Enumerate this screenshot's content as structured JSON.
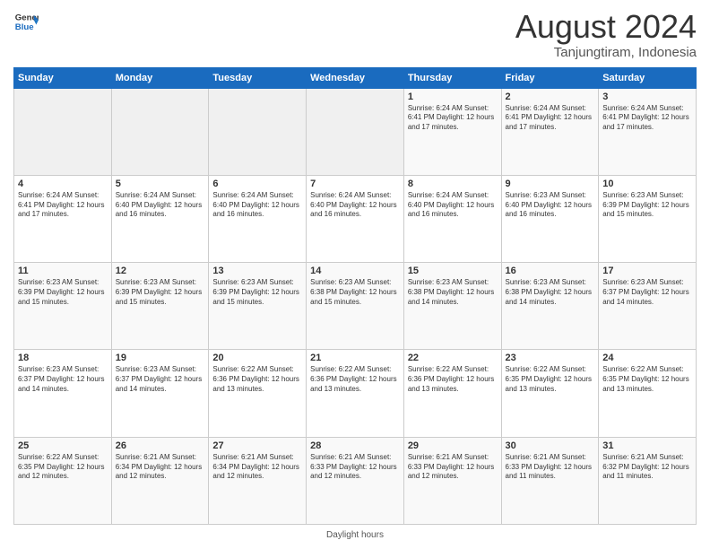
{
  "header": {
    "logo_line1": "General",
    "logo_line2": "Blue",
    "main_title": "August 2024",
    "subtitle": "Tanjungtiram, Indonesia"
  },
  "days_of_week": [
    "Sunday",
    "Monday",
    "Tuesday",
    "Wednesday",
    "Thursday",
    "Friday",
    "Saturday"
  ],
  "weeks": [
    [
      {
        "day": "",
        "info": ""
      },
      {
        "day": "",
        "info": ""
      },
      {
        "day": "",
        "info": ""
      },
      {
        "day": "",
        "info": ""
      },
      {
        "day": "1",
        "info": "Sunrise: 6:24 AM\nSunset: 6:41 PM\nDaylight: 12 hours and 17 minutes."
      },
      {
        "day": "2",
        "info": "Sunrise: 6:24 AM\nSunset: 6:41 PM\nDaylight: 12 hours and 17 minutes."
      },
      {
        "day": "3",
        "info": "Sunrise: 6:24 AM\nSunset: 6:41 PM\nDaylight: 12 hours and 17 minutes."
      }
    ],
    [
      {
        "day": "4",
        "info": "Sunrise: 6:24 AM\nSunset: 6:41 PM\nDaylight: 12 hours and 17 minutes."
      },
      {
        "day": "5",
        "info": "Sunrise: 6:24 AM\nSunset: 6:40 PM\nDaylight: 12 hours and 16 minutes."
      },
      {
        "day": "6",
        "info": "Sunrise: 6:24 AM\nSunset: 6:40 PM\nDaylight: 12 hours and 16 minutes."
      },
      {
        "day": "7",
        "info": "Sunrise: 6:24 AM\nSunset: 6:40 PM\nDaylight: 12 hours and 16 minutes."
      },
      {
        "day": "8",
        "info": "Sunrise: 6:24 AM\nSunset: 6:40 PM\nDaylight: 12 hours and 16 minutes."
      },
      {
        "day": "9",
        "info": "Sunrise: 6:23 AM\nSunset: 6:40 PM\nDaylight: 12 hours and 16 minutes."
      },
      {
        "day": "10",
        "info": "Sunrise: 6:23 AM\nSunset: 6:39 PM\nDaylight: 12 hours and 15 minutes."
      }
    ],
    [
      {
        "day": "11",
        "info": "Sunrise: 6:23 AM\nSunset: 6:39 PM\nDaylight: 12 hours and 15 minutes."
      },
      {
        "day": "12",
        "info": "Sunrise: 6:23 AM\nSunset: 6:39 PM\nDaylight: 12 hours and 15 minutes."
      },
      {
        "day": "13",
        "info": "Sunrise: 6:23 AM\nSunset: 6:39 PM\nDaylight: 12 hours and 15 minutes."
      },
      {
        "day": "14",
        "info": "Sunrise: 6:23 AM\nSunset: 6:38 PM\nDaylight: 12 hours and 15 minutes."
      },
      {
        "day": "15",
        "info": "Sunrise: 6:23 AM\nSunset: 6:38 PM\nDaylight: 12 hours and 14 minutes."
      },
      {
        "day": "16",
        "info": "Sunrise: 6:23 AM\nSunset: 6:38 PM\nDaylight: 12 hours and 14 minutes."
      },
      {
        "day": "17",
        "info": "Sunrise: 6:23 AM\nSunset: 6:37 PM\nDaylight: 12 hours and 14 minutes."
      }
    ],
    [
      {
        "day": "18",
        "info": "Sunrise: 6:23 AM\nSunset: 6:37 PM\nDaylight: 12 hours and 14 minutes."
      },
      {
        "day": "19",
        "info": "Sunrise: 6:23 AM\nSunset: 6:37 PM\nDaylight: 12 hours and 14 minutes."
      },
      {
        "day": "20",
        "info": "Sunrise: 6:22 AM\nSunset: 6:36 PM\nDaylight: 12 hours and 13 minutes."
      },
      {
        "day": "21",
        "info": "Sunrise: 6:22 AM\nSunset: 6:36 PM\nDaylight: 12 hours and 13 minutes."
      },
      {
        "day": "22",
        "info": "Sunrise: 6:22 AM\nSunset: 6:36 PM\nDaylight: 12 hours and 13 minutes."
      },
      {
        "day": "23",
        "info": "Sunrise: 6:22 AM\nSunset: 6:35 PM\nDaylight: 12 hours and 13 minutes."
      },
      {
        "day": "24",
        "info": "Sunrise: 6:22 AM\nSunset: 6:35 PM\nDaylight: 12 hours and 13 minutes."
      }
    ],
    [
      {
        "day": "25",
        "info": "Sunrise: 6:22 AM\nSunset: 6:35 PM\nDaylight: 12 hours and 12 minutes."
      },
      {
        "day": "26",
        "info": "Sunrise: 6:21 AM\nSunset: 6:34 PM\nDaylight: 12 hours and 12 minutes."
      },
      {
        "day": "27",
        "info": "Sunrise: 6:21 AM\nSunset: 6:34 PM\nDaylight: 12 hours and 12 minutes."
      },
      {
        "day": "28",
        "info": "Sunrise: 6:21 AM\nSunset: 6:33 PM\nDaylight: 12 hours and 12 minutes."
      },
      {
        "day": "29",
        "info": "Sunrise: 6:21 AM\nSunset: 6:33 PM\nDaylight: 12 hours and 12 minutes."
      },
      {
        "day": "30",
        "info": "Sunrise: 6:21 AM\nSunset: 6:33 PM\nDaylight: 12 hours and 11 minutes."
      },
      {
        "day": "31",
        "info": "Sunrise: 6:21 AM\nSunset: 6:32 PM\nDaylight: 12 hours and 11 minutes."
      }
    ]
  ],
  "footer_text": "Daylight hours"
}
